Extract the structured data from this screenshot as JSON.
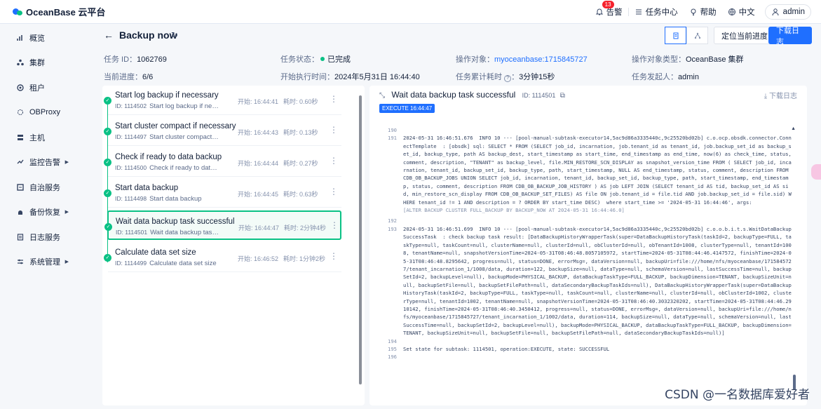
{
  "app": {
    "title": "OceanBase 云平台"
  },
  "topbar": {
    "alerts_label": "告警",
    "alerts_count": "13",
    "tasks_label": "任务中心",
    "help_label": "帮助",
    "lang_label": "中文",
    "user_label": "admin"
  },
  "sidebar": {
    "items": [
      {
        "label": "概览",
        "icon": "bar-chart-icon",
        "has_arrow": false
      },
      {
        "label": "集群",
        "icon": "cluster-icon",
        "has_arrow": false
      },
      {
        "label": "租户",
        "icon": "tenant-icon",
        "has_arrow": false
      },
      {
        "label": "OBProxy",
        "icon": "proxy-icon",
        "has_arrow": false
      },
      {
        "label": "主机",
        "icon": "host-icon",
        "has_arrow": false
      },
      {
        "label": "监控告警",
        "icon": "monitor-icon",
        "has_arrow": true
      },
      {
        "label": "自治服务",
        "icon": "autonomy-icon",
        "has_arrow": false
      },
      {
        "label": "备份恢复",
        "icon": "backup-icon",
        "has_arrow": true
      },
      {
        "label": "日志服务",
        "icon": "log-icon",
        "has_arrow": false
      },
      {
        "label": "系统管理",
        "icon": "settings-icon",
        "has_arrow": true
      }
    ]
  },
  "header": {
    "title": "Backup now",
    "locate_button": "定位当前进度",
    "download_button": "下载日志",
    "meta": {
      "task_id_label": "任务 ID：",
      "task_id": "1062769",
      "status_label": "任务状态：",
      "status": "已完成",
      "target_label": "操作对象：",
      "target": "myoceanbase:1715845727",
      "target_type_label": "操作对象类型：",
      "target_type": "OceanBase 集群",
      "progress_label": "当前进度：",
      "progress": "6/6",
      "start_time_label": "开始执行时间：",
      "start_time": "2024年5月31日 16:44:40",
      "elapsed_label": "任务累计耗时",
      "elapsed": "3分钟15秒",
      "initiator_label": "任务发起人：",
      "initiator": "admin"
    }
  },
  "tasks": [
    {
      "name": "Start log backup if necessary",
      "id": "ID: 1114502",
      "desc": "Start log backup if nec...",
      "start": "开始: 16:44:41",
      "duration": "耗时: 0.60秒",
      "selected": false
    },
    {
      "name": "Start cluster compact if necessary",
      "id": "ID: 1114497",
      "desc": "Start cluster compact if ...",
      "start": "开始: 16:44:43",
      "duration": "耗时: 0.13秒",
      "selected": false
    },
    {
      "name": "Check if ready to data backup",
      "id": "ID: 1114500",
      "desc": "Check if ready to data ...",
      "start": "开始: 16:44:44",
      "duration": "耗时: 0.27秒",
      "selected": false
    },
    {
      "name": "Start data backup",
      "id": "ID: 1114498",
      "desc": "Start data backup",
      "start": "开始: 16:44:45",
      "duration": "耗时: 0.63秒",
      "selected": false
    },
    {
      "name": "Wait data backup task successful",
      "id": "ID: 1114501",
      "desc": "Wait data backup task ...",
      "start": "开始: 16:44:47",
      "duration": "耗时: 2分钟4秒",
      "selected": true
    },
    {
      "name": "Calculate data set size",
      "id": "ID: 1114499",
      "desc": "Calculate data set size",
      "start": "开始: 16:46:52",
      "duration": "耗时: 1分钟2秒",
      "selected": false
    }
  ],
  "log": {
    "title": "Wait data backup task successful",
    "id": "ID: 1114501",
    "download": "下载日志",
    "exec_tag": "EXECUTE 16:44:47",
    "lines": [
      {
        "n": "190",
        "t": ""
      },
      {
        "n": "191",
        "t": "2024-05-31 16:46:51.676  INFO 10 --- [pool-manual-subtask-executor14,5ac9d86a3335440c,9c25520bd02b] c.o.ocp.obsdk.connector.ConnectTemplate  : [obsdk] sql: SELECT * FROM (SELECT job_id, incarnation, job.tenant_id as tenant_id, job.backup_set_id as backup_set_id, backup_type, path AS backup_dest, start_timestamp as start_time, end_timestamp as end_time, now(6) as check_time, status, comment, description, \"TENANT\" as backup_level, file.MIN_RESTORE_SCN_DISPLAY as snapshot_version_time FROM ( SELECT job_id, incarnation, tenant_id, backup_set_id, backup_type, path, start_timestamp, NULL AS end_timestamp, status, comment, description FROM CDB_OB_BACKUP_JOBS UNION SELECT job_id, incarnation, tenant_id, backup_set_id, backup_type, path, start_timestamp, end_timestamp, status, comment, description FROM CDB_OB_BACKUP_JOB_HISTORY ) AS job LEFT JOIN (SELECT tenant_id AS tid, backup_set_id AS sid, min_restore_scn_display FROM CDB_OB_BACKUP_SET_FILES) AS file ON job.tenant_id = file.tid AND job.backup_set_id = file.sid) WHERE tenant_id != 1 AND description = ? ORDER BY start_time DESC)  where start_time >= '2024-05-31 16:44:46', args:"
      },
      {
        "n": "",
        "t": "[ALTER BACKUP CLUSTER FULL_BACKUP BY BACKUP_NOW AT 2024-05-31 16:44:46.0]"
      },
      {
        "n": "192",
        "t": ""
      },
      {
        "n": "193",
        "t": "2024-05-31 16:46:51.699  INFO 10 --- [pool-manual-subtask-executor14,5ac9d86a3335440c,9c25520bd02b] c.o.o.b.i.t.s.WaitDataBackupSuccessTask  : check backup task result: [DataBackupHistoryWrapperTask(super=DataBackupHistoryTask(taskId=2, backupType=FULL, taskType=null, taskCount=null, clusterName=null, clusterId=null, obClusterId=null, obTenantId=1008, clusterType=null, tenantId=1008, tenantName=null, snapshotVersionTime=2024-05-31T08:46:48.8057105972, startTime=2024-05-31T08:44:46.4147572, finishTime=2024-05-31T08:46:48.8295642, progress=null, status=DONE, errorMsg=, dataVersion=null, backupUri=file:///home/nfs/myoceanbase/1715845727/tenant_incarnation_1/1008/data, duration=122, backupSize=null, dataType=null, schemaVersion=null, lastSuccessTime=null, backupSetId=2, backupLevel=null), backupMode=PHYSICAL_BACKUP, dataBackupTaskType=FULL_BACKUP, backupDimension=TENANT, backupSizeUnit=null, backupSetFile=null, backupSetFilePath=null, dataSecondaryBackupTaskIds=null), DataBackupHistoryWrapperTask(super=DataBackupHistoryTask(taskId=2, backupType=FULL, taskType=null, taskCount=null, clusterName=null, clusterId=null, obClusterId=1002, clusterType=null, tenantId=1002, tenantName=null, snapshotVersionTime=2024-05-31T08:46:40.3032320202, startTime=2024-05-31T08:44:46.2910142, finishTime=2024-05-31T08:46:40.3450412, progress=null, status=DONE, errorMsg=, dataVersion=null, backupUri=file:///home/nfs/myoceanbase/1715845727/tenant_incarnation_1/1002/data, duration=114, backupSize=null, dataType=null, schemaVersion=null, lastSuccessTime=null, backupSetId=2, backupLevel=null), backupMode=PHYSICAL_BACKUP, dataBackupTaskType=FULL_BACKUP, backupDimension=TENANT, backupSizeUnit=null, backupSetFile=null, backupSetFilePath=null, dataSecondaryBackupTaskIds=null)]"
      },
      {
        "n": "194",
        "t": ""
      },
      {
        "n": "195",
        "t": "Set state for subtask: 1114501, operation:EXECUTE, state: SUCCESSFUL"
      },
      {
        "n": "196",
        "t": ""
      }
    ]
  },
  "watermark": "CSDN @一名数据库爱好者",
  "colors": {
    "primary": "#1f6fff",
    "success": "#0ac185",
    "text": "#132039"
  }
}
